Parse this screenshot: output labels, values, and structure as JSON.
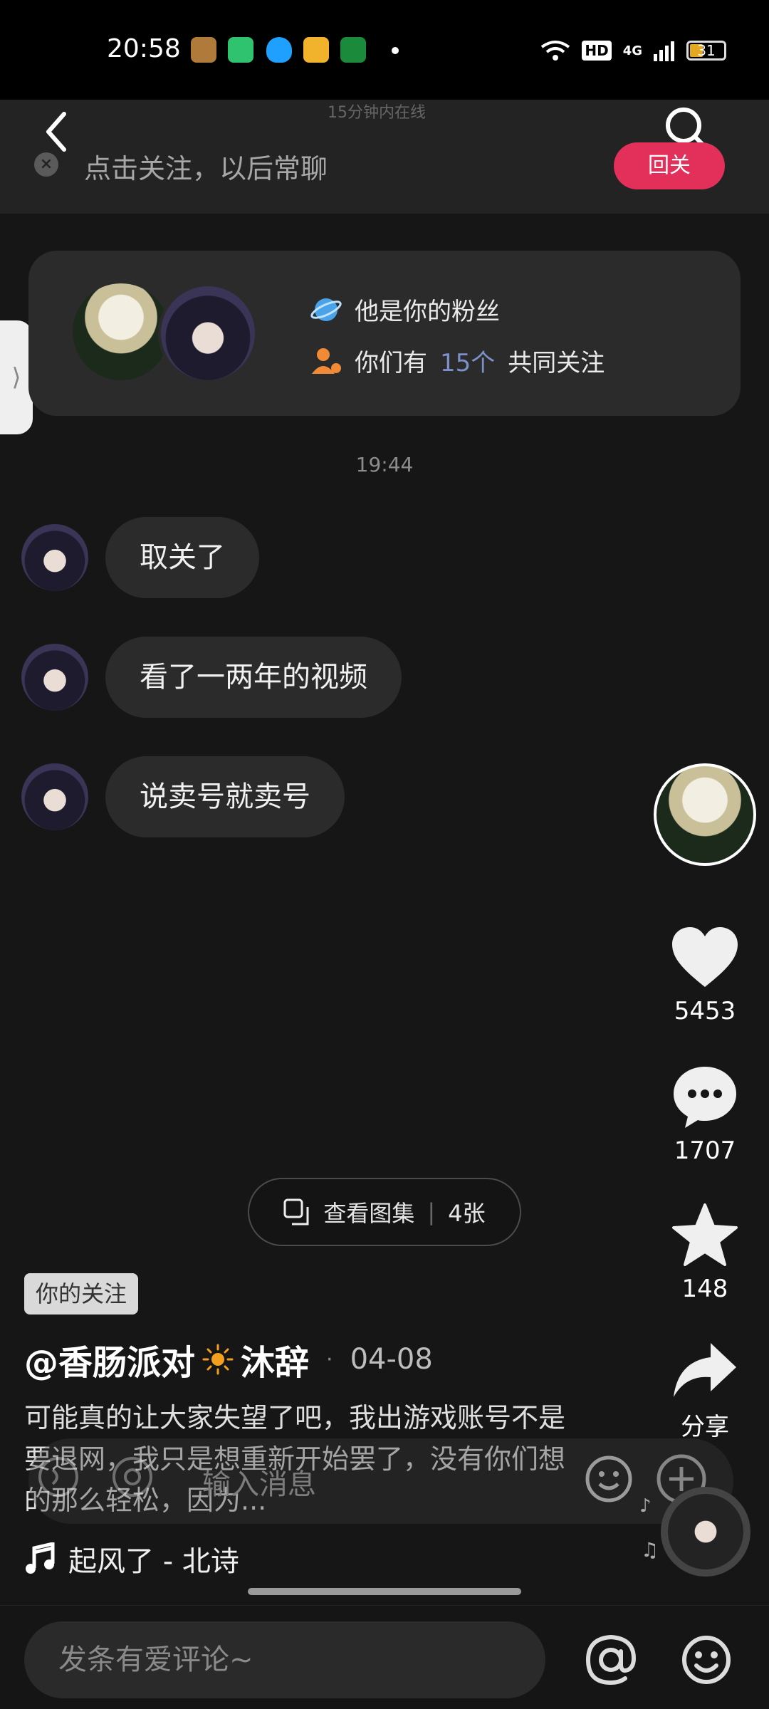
{
  "status_bar": {
    "time": "20:58",
    "network_label": "4G",
    "hd_label": "HD",
    "battery": "31"
  },
  "header": {
    "faded_text": "15分钟内在线",
    "follow_prompt": "点击关注，以后常聊",
    "follow_back_label": "回关"
  },
  "fan_card": {
    "fan_text": "他是你的粉丝",
    "mutual_prefix": "你们有",
    "mutual_count": "15个",
    "mutual_suffix": "共同关注"
  },
  "chat": {
    "timestamp": "19:44",
    "messages": [
      "取关了",
      "看了一两年的视频",
      "说卖号就卖号"
    ]
  },
  "actions": {
    "likes": "5453",
    "comments": "1707",
    "favorites": "148",
    "share": "分享"
  },
  "gallery": {
    "label": "查看图集",
    "count": "4张"
  },
  "post": {
    "tag": "你的关注",
    "author_prefix": "@香肠派对",
    "author_suffix": "沐辞",
    "date": "04-08",
    "caption": "可能真的让大家失望了吧，我出游戏账号不是要退网，我只是想重新开始罢了，没有你们想的那么轻松，因为...",
    "overlay_input": "输入消息",
    "music": "起风了 - 北诗"
  },
  "bottom": {
    "comment_placeholder": "发条有爱评论~"
  },
  "colors": {
    "accent": "#e2305a",
    "mutual_number": "#7d90c8"
  }
}
